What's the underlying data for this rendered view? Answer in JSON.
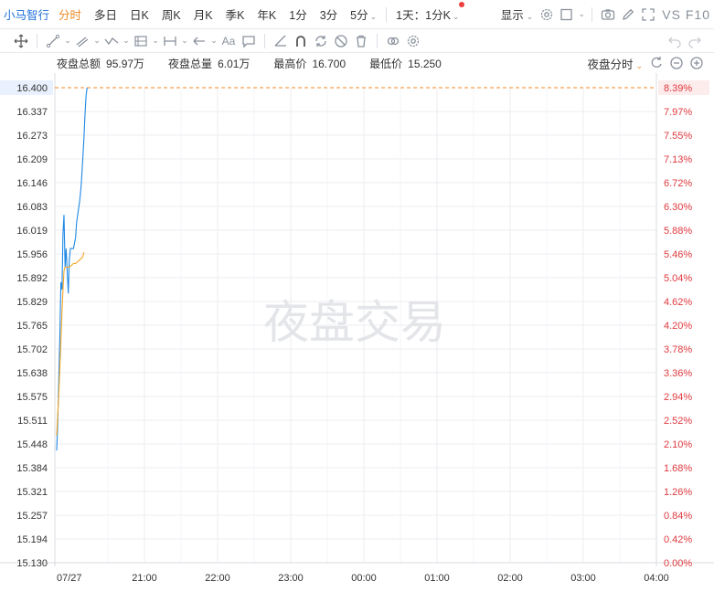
{
  "toolbar": {
    "stock_name": "小马智行",
    "tabs": [
      "分时",
      "多日",
      "日K",
      "周K",
      "月K",
      "季K",
      "年K",
      "1分",
      "3分",
      "5分",
      "1天：1分K"
    ],
    "active_tab": 0,
    "display_label": "显示",
    "vsf10_label": "VS F10",
    "text_tool_label": "Aa"
  },
  "info": {
    "turnover_label": "夜盘总额",
    "turnover_value": "95.97万",
    "volume_label": "夜盘总量",
    "volume_value": "6.01万",
    "high_label": "最高价",
    "high_value": "16.700",
    "low_label": "最低价",
    "low_value": "15.250",
    "mode_label": "夜盘分时"
  },
  "chart_data": {
    "type": "line",
    "watermark": "夜盘交易",
    "ylim": [
      15.13,
      16.4
    ],
    "price_ticks": [
      "16.400",
      "16.337",
      "16.273",
      "16.209",
      "16.146",
      "16.083",
      "16.019",
      "15.956",
      "15.892",
      "15.829",
      "15.765",
      "15.702",
      "15.638",
      "15.575",
      "15.511",
      "15.448",
      "15.384",
      "15.321",
      "15.257",
      "15.194",
      "15.130"
    ],
    "pct_ticks": [
      "8.39%",
      "7.97%",
      "7.55%",
      "7.13%",
      "6.72%",
      "6.30%",
      "5.88%",
      "5.46%",
      "5.04%",
      "4.62%",
      "4.20%",
      "3.78%",
      "3.36%",
      "2.94%",
      "2.52%",
      "2.10%",
      "1.68%",
      "1.26%",
      "0.84%",
      "0.42%",
      "0.00%"
    ],
    "x_ticks": [
      "07/27",
      "21:00",
      "22:00",
      "23:00",
      "00:00",
      "01:00",
      "02:00",
      "03:00",
      "04:00"
    ],
    "reference_price": 16.4,
    "colors": {
      "price": "#1e88e5",
      "average": "#f5a623",
      "reference": "#f08a24",
      "tick_red": "#e0393e",
      "grid": "#eceef2",
      "watermark": "#e3e5e9"
    },
    "series": [
      {
        "key": "price",
        "points": [
          [
            0,
            15.43
          ],
          [
            0.5,
            15.5
          ],
          [
            1,
            15.62
          ],
          [
            1.5,
            15.74
          ],
          [
            2,
            15.88
          ],
          [
            2.5,
            15.86
          ],
          [
            3,
            16.01
          ],
          [
            3.5,
            16.06
          ],
          [
            4,
            15.92
          ],
          [
            4.5,
            15.97
          ],
          [
            5,
            15.91
          ],
          [
            5.5,
            15.85
          ],
          [
            6,
            15.94
          ],
          [
            6.5,
            15.97
          ],
          [
            7,
            15.97
          ],
          [
            8,
            15.97
          ],
          [
            9,
            16.0
          ],
          [
            9.5,
            16.04
          ],
          [
            10,
            16.06
          ],
          [
            11,
            16.1
          ],
          [
            11.5,
            16.13
          ],
          [
            12,
            16.17
          ],
          [
            12.5,
            16.22
          ],
          [
            13,
            16.27
          ],
          [
            13.5,
            16.33
          ],
          [
            14,
            16.38
          ],
          [
            14.5,
            16.4
          ]
        ]
      },
      {
        "key": "average",
        "points": [
          [
            0,
            15.47
          ],
          [
            1,
            15.58
          ],
          [
            2,
            15.72
          ],
          [
            2.5,
            15.8
          ],
          [
            3,
            15.86
          ],
          [
            3.5,
            15.91
          ],
          [
            4,
            15.92
          ],
          [
            5,
            15.92
          ],
          [
            6,
            15.92
          ],
          [
            7,
            15.925
          ],
          [
            8,
            15.93
          ],
          [
            9,
            15.93
          ],
          [
            10,
            15.935
          ],
          [
            11,
            15.94
          ],
          [
            12,
            15.945
          ],
          [
            12.5,
            15.95
          ],
          [
            13,
            15.96
          ]
        ]
      }
    ]
  }
}
